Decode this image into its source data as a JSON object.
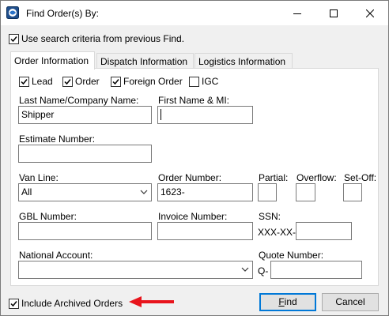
{
  "window": {
    "title": "Find Order(s) By:"
  },
  "use_previous": {
    "label": "Use search criteria from previous Find.",
    "checked": true
  },
  "tabs": [
    {
      "label": "Order Information",
      "active": true
    },
    {
      "label": "Dispatch Information",
      "active": false
    },
    {
      "label": "Logistics Information",
      "active": false
    }
  ],
  "filters": [
    {
      "label": "Lead",
      "checked": true
    },
    {
      "label": "Order",
      "checked": true
    },
    {
      "label": "Foreign Order",
      "checked": true
    },
    {
      "label": "IGC",
      "checked": false
    }
  ],
  "fields": {
    "last_name": {
      "label": "Last Name/Company Name:",
      "value": "Shipper"
    },
    "first_name": {
      "label": "First Name & MI:",
      "value": ""
    },
    "estimate": {
      "label": "Estimate Number:",
      "value": ""
    },
    "van_line": {
      "label": "Van Line:",
      "value": "All"
    },
    "order_number": {
      "label": "Order Number:",
      "value": "1623-"
    },
    "partial": {
      "label": "Partial:",
      "value": ""
    },
    "overflow": {
      "label": "Overflow:",
      "value": ""
    },
    "set_off": {
      "label": "Set-Off:",
      "value": ""
    },
    "gbl": {
      "label": "GBL Number:",
      "value": ""
    },
    "invoice": {
      "label": "Invoice Number:",
      "value": ""
    },
    "ssn": {
      "label": "SSN:",
      "prefix": "XXX-XX-",
      "value": ""
    },
    "national_account": {
      "label": "National Account:",
      "value": ""
    },
    "quote": {
      "label": "Quote Number:",
      "prefix": "Q-",
      "value": ""
    }
  },
  "include_archived": {
    "label": "Include Archived Orders",
    "checked": true
  },
  "buttons": {
    "find_underlined": "F",
    "find_rest": "ind",
    "cancel": "Cancel"
  },
  "colors": {
    "accent": "#0078d7",
    "arrow": "#e8141c"
  }
}
